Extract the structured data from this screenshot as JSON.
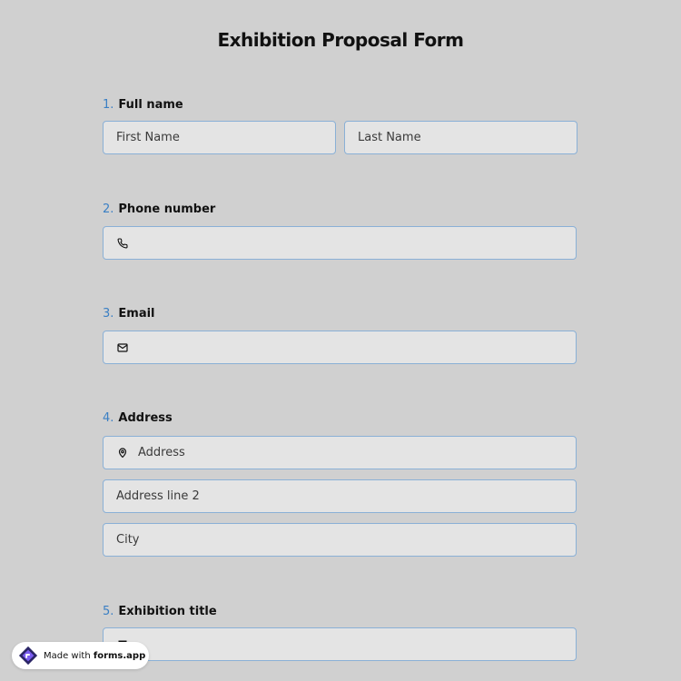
{
  "form": {
    "title": "Exhibition Proposal Form"
  },
  "questions": [
    {
      "number": "1.",
      "label": "Full name"
    },
    {
      "number": "2.",
      "label": "Phone number"
    },
    {
      "number": "3.",
      "label": "Email"
    },
    {
      "number": "4.",
      "label": "Address"
    },
    {
      "number": "5.",
      "label": "Exhibition title"
    }
  ],
  "fields": {
    "first_name": {
      "placeholder": "First Name",
      "value": ""
    },
    "last_name": {
      "placeholder": "Last Name",
      "value": ""
    },
    "phone": {
      "placeholder": "",
      "value": "",
      "icon": "phone-icon"
    },
    "email": {
      "placeholder": "",
      "value": "",
      "icon": "mail-icon"
    },
    "address": {
      "placeholder": "Address",
      "value": "",
      "icon": "location-pin-icon"
    },
    "address_line2": {
      "placeholder": "Address line 2",
      "value": ""
    },
    "city": {
      "placeholder": "City",
      "value": ""
    },
    "exhibition_title": {
      "placeholder": "",
      "value": "",
      "icon": "text-icon"
    }
  },
  "branding": {
    "made_with": "Made with",
    "brand": "forms.app",
    "logo": "forms-app-logo"
  },
  "colors": {
    "background": "#d0d0d0",
    "field_bg": "#e4e4e4",
    "field_border": "#8ab0d6",
    "number_accent": "#3a7fc4"
  }
}
